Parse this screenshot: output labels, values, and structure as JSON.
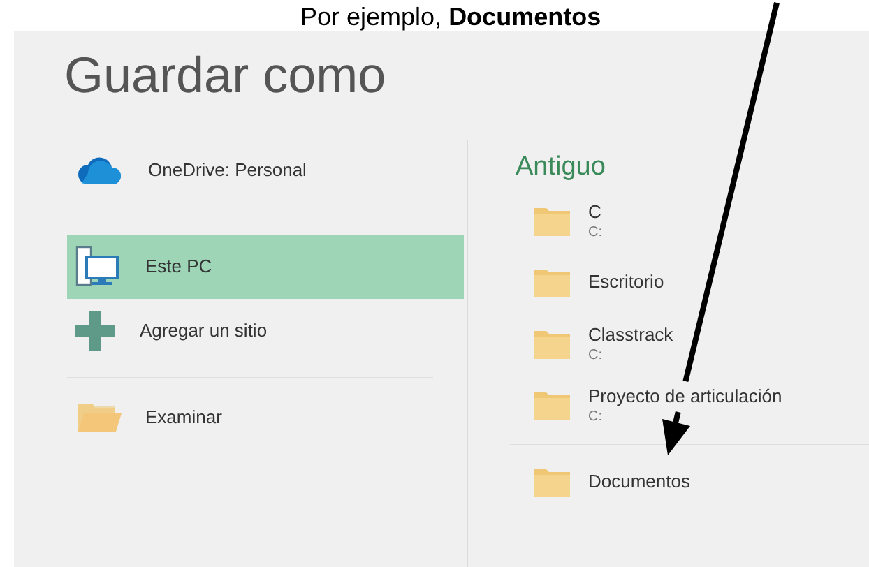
{
  "caption": "Por ejemplo, **Documentos**",
  "title": "Guardar como",
  "places": [
    {
      "kind": "cloud",
      "label": "OneDrive: Personal",
      "selected": false
    },
    {
      "kind": "pc",
      "label": "Este PC",
      "selected": true
    },
    {
      "kind": "add",
      "label": "Agregar un sitio",
      "selected": false
    }
  ],
  "browse": {
    "label": "Examinar"
  },
  "recent": {
    "heading": "Antiguo",
    "folders": [
      {
        "name": "C",
        "path": "C:"
      },
      {
        "name": "Escritorio"
      },
      {
        "name": "Classtrack",
        "path": "C:"
      },
      {
        "name": "Proyecto de articulación",
        "path": "C:"
      }
    ]
  },
  "other_folders": [
    {
      "name": "Documentos"
    }
  ]
}
